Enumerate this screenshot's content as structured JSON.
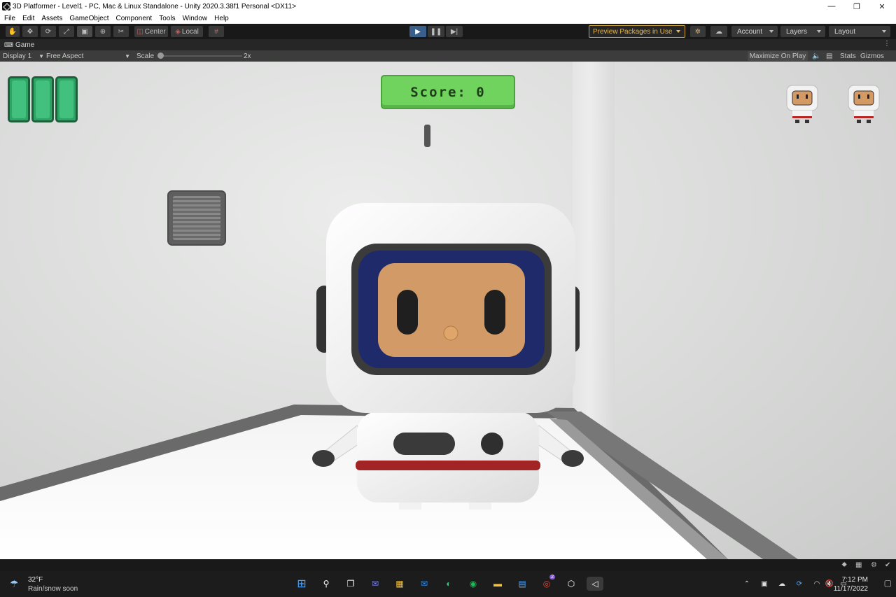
{
  "window": {
    "title": "3D Platformer - Level1 - PC, Mac & Linux Standalone - Unity 2020.3.38f1 Personal <DX11>",
    "controls": [
      "—",
      "❐",
      "✕"
    ]
  },
  "menu": [
    "File",
    "Edit",
    "Assets",
    "GameObject",
    "Component",
    "Tools",
    "Window",
    "Help"
  ],
  "toolbar": {
    "pivot_label": "Center",
    "space_label": "Local",
    "preview_packages": "Preview Packages in Use",
    "account": "Account",
    "layers": "Layers",
    "layout": "Layout"
  },
  "game_tab": {
    "label": "Game"
  },
  "game_bar": {
    "display": "Display 1",
    "aspect": "Free Aspect",
    "scale_label": "Scale",
    "scale_value": "2x",
    "maximize": "Maximize On Play",
    "stats": "Stats",
    "gizmos": "Gizmos"
  },
  "hud": {
    "score": "Score: 0",
    "health_segments": 3,
    "lives": 2
  },
  "taskbar": {
    "weather_temp": "32°F",
    "weather_desc": "Rain/snow soon",
    "time": "7:12 PM",
    "date": "11/17/2022",
    "notification_badge": "2"
  },
  "colors": {
    "score_bg": "#6fd35e",
    "health": "#2fa565",
    "preview_accent": "#e8b84d",
    "play_active": "#3a5f8a"
  }
}
